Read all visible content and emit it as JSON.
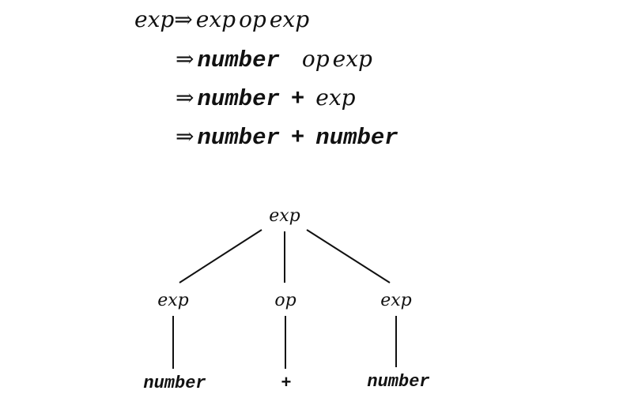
{
  "derivation": {
    "line1": {
      "lhs": "exp",
      "arrow": "⇒",
      "exp_a": "exp",
      "op": "op",
      "exp_b": "exp"
    },
    "line2": {
      "arrow": "⇒",
      "number": "number",
      "op": "op",
      "exp": "exp"
    },
    "line3": {
      "arrow": "⇒",
      "number": "number",
      "plus": "+",
      "exp": "exp"
    },
    "line4": {
      "arrow": "⇒",
      "number_a": "number",
      "plus": "+",
      "number_b": "number"
    }
  },
  "parse_tree": {
    "root": "exp",
    "children": [
      {
        "label": "exp",
        "leaf": "number"
      },
      {
        "label": "op",
        "leaf": "+"
      },
      {
        "label": "exp",
        "leaf": "number"
      }
    ]
  }
}
